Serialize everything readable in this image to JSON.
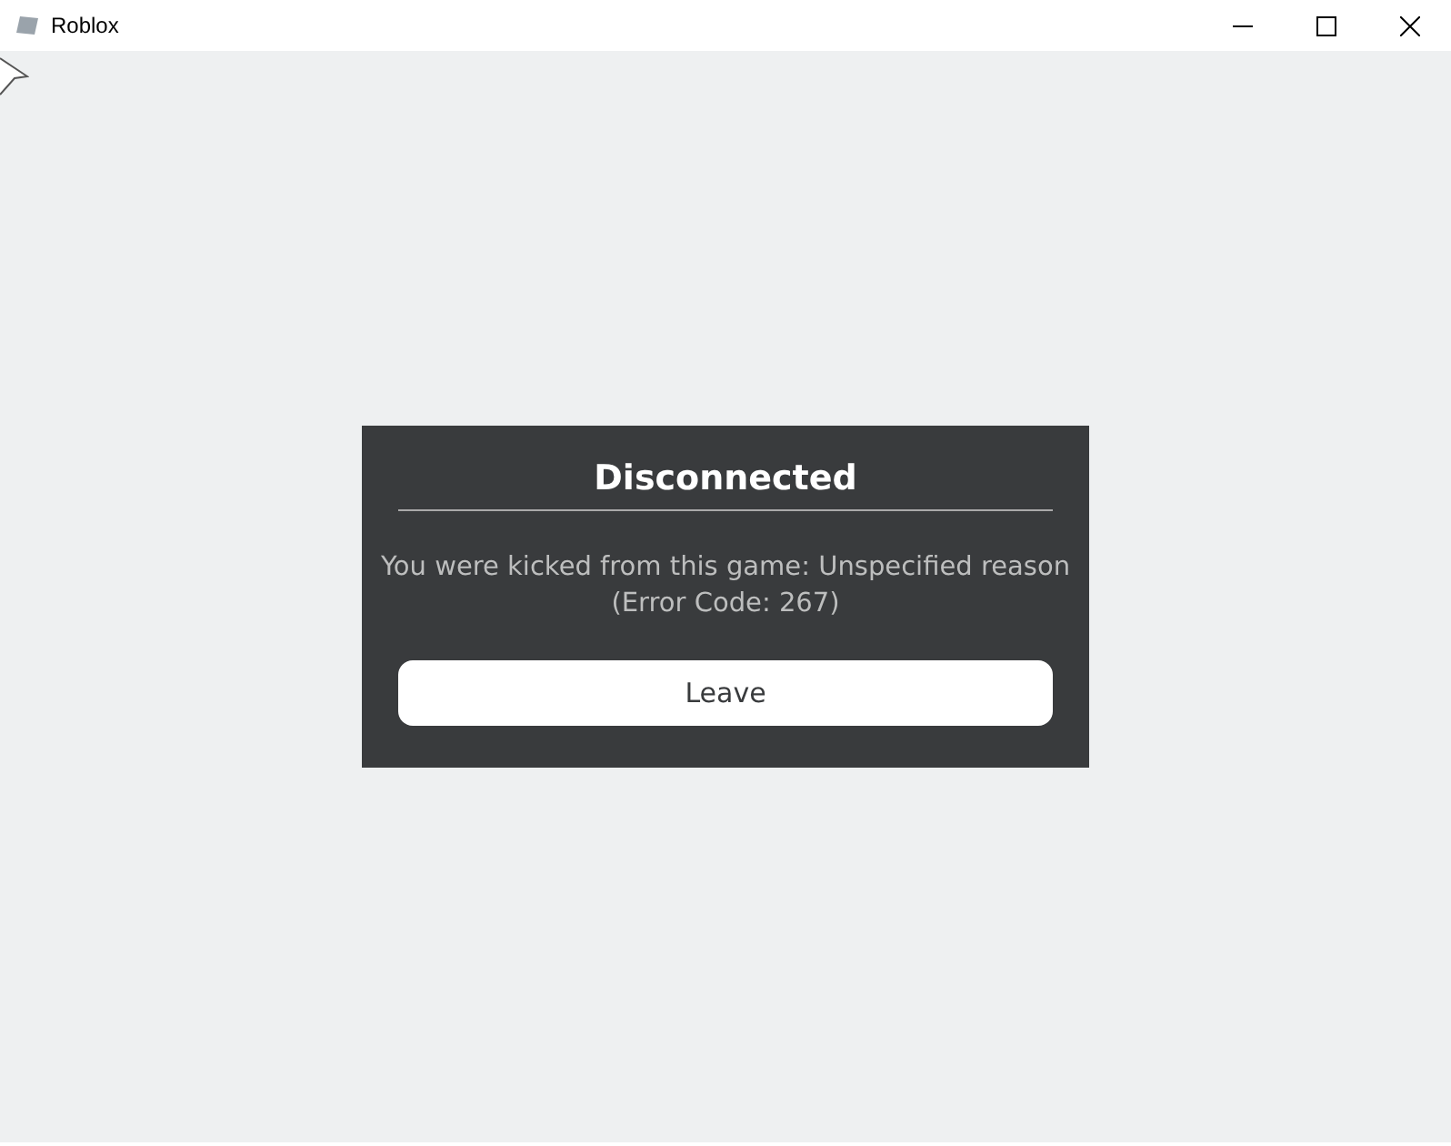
{
  "window": {
    "title": "Roblox"
  },
  "dialog": {
    "title": "Disconnected",
    "message": "You were kicked from this game: Unspecified reason",
    "detail": "(Error Code: 267)",
    "button": "Leave"
  }
}
